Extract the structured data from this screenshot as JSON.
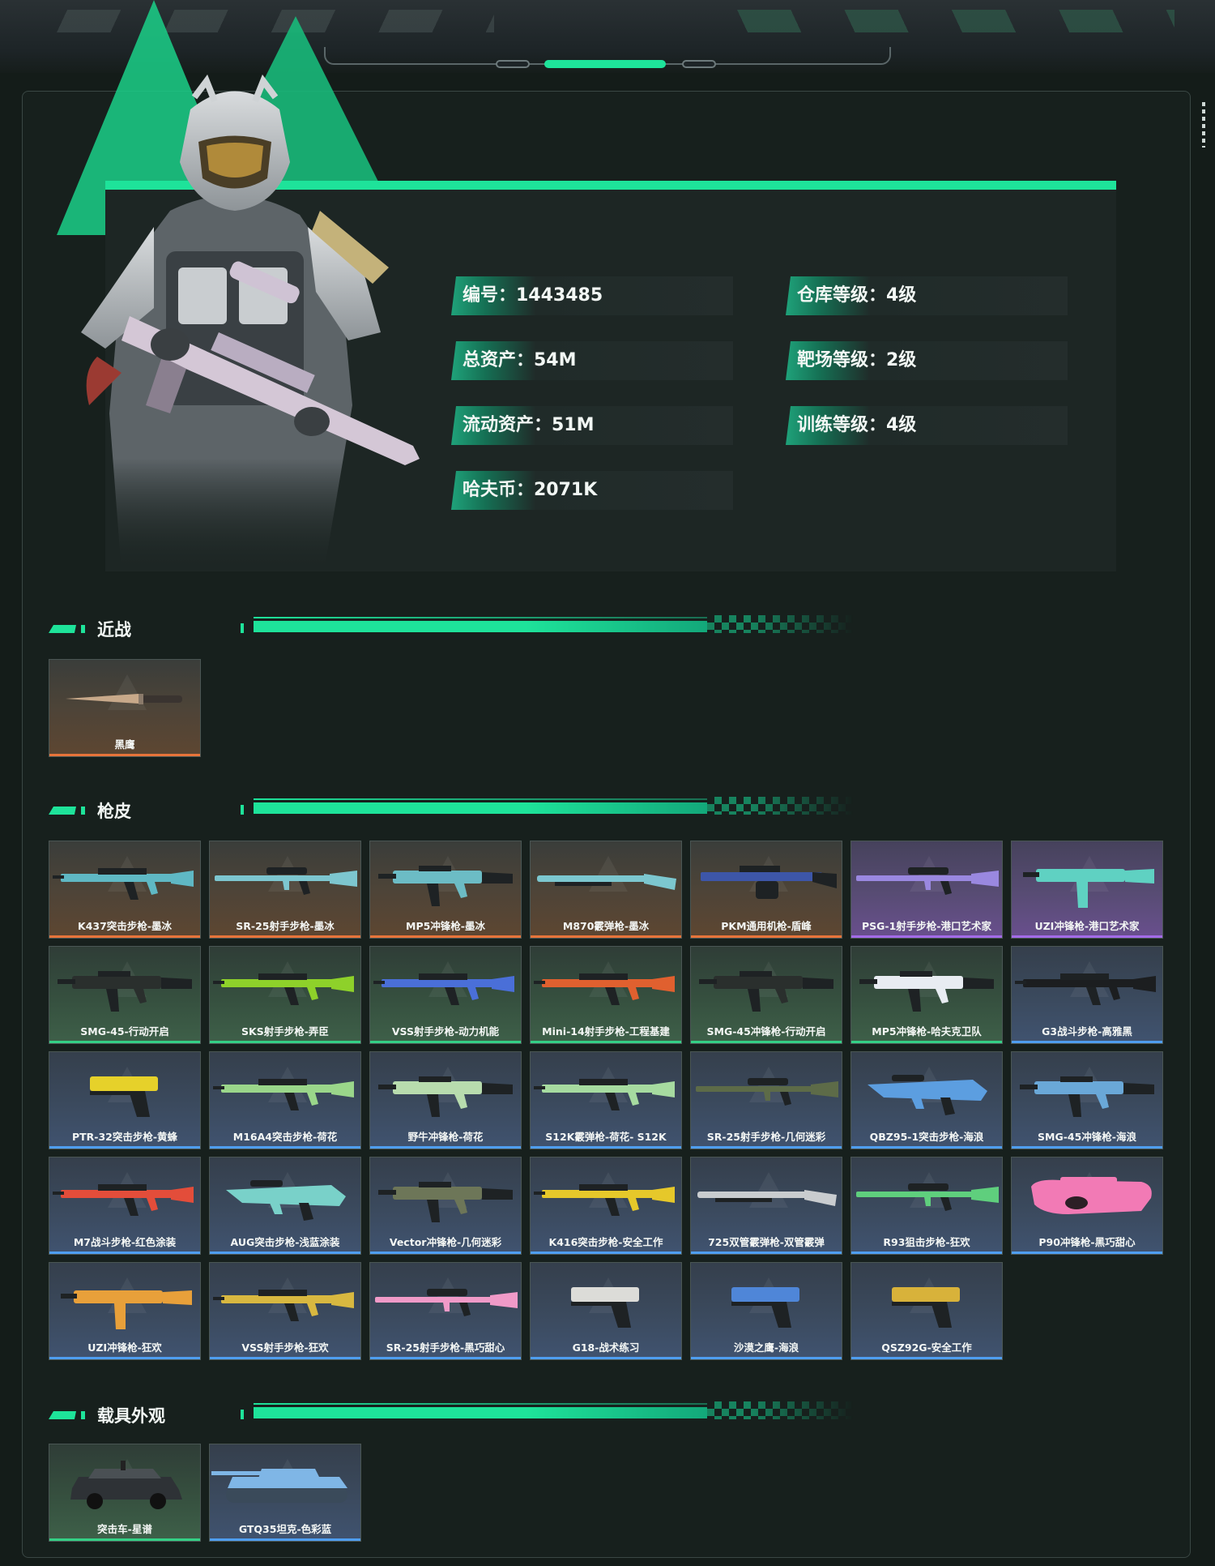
{
  "profile": {
    "stats": [
      {
        "key": "id",
        "text": "编号：1443485"
      },
      {
        "key": "warehouse",
        "text": "仓库等级：4级"
      },
      {
        "key": "assets",
        "text": "总资产：54M"
      },
      {
        "key": "range",
        "text": "靶场等级：2级"
      },
      {
        "key": "liquid",
        "text": "流动资产：51M"
      },
      {
        "key": "training",
        "text": "训练等级：4级"
      },
      {
        "key": "havcoin",
        "text": "哈夫币：2071K"
      }
    ]
  },
  "sections": {
    "melee": {
      "title": "近战",
      "items": [
        {
          "name": "黑鹰",
          "quality": "orange",
          "kind": "knife",
          "color": "#c8a98a"
        }
      ]
    },
    "skins": {
      "title": "枪皮",
      "items": [
        {
          "name": "K437突击步枪-墨冰",
          "quality": "orange",
          "kind": "rifle",
          "color": "#5fb8c4"
        },
        {
          "name": "SR-25射手步枪-墨冰",
          "quality": "orange",
          "kind": "sniper",
          "color": "#7dc6cf"
        },
        {
          "name": "MP5冲锋枪-墨冰",
          "quality": "orange",
          "kind": "smg",
          "color": "#6cbcc5"
        },
        {
          "name": "M870霰弹枪-墨冰",
          "quality": "orange",
          "kind": "shotgun",
          "color": "#7cc7cf"
        },
        {
          "name": "PKM通用机枪-盾峰",
          "quality": "orange",
          "kind": "lmg",
          "color": "#3d56a8"
        },
        {
          "name": "PSG-1射手步枪-港口艺术家",
          "quality": "purple",
          "kind": "sniper",
          "color": "#9a88e0"
        },
        {
          "name": "UZI冲锋枪-港口艺术家",
          "quality": "purple",
          "kind": "uzi",
          "color": "#5fd1c2"
        },
        {
          "name": "SMG-45-行动开启",
          "quality": "green",
          "kind": "smg",
          "color": "#2a2f2d"
        },
        {
          "name": "SKS射手步枪-弄臣",
          "quality": "green",
          "kind": "rifle",
          "color": "#8ed12a"
        },
        {
          "name": "VSS射手步枪-动力机能",
          "quality": "green",
          "kind": "rifle",
          "color": "#4a6fd8"
        },
        {
          "name": "Mini-14射手步枪-工程基建",
          "quality": "green",
          "kind": "rifle",
          "color": "#e0602f"
        },
        {
          "name": "SMG-45冲锋枪-行动开启",
          "quality": "green",
          "kind": "smg",
          "color": "#2a2f2d"
        },
        {
          "name": "MP5冲锋枪-哈夫克卫队",
          "quality": "green",
          "kind": "smg",
          "color": "#e8ecf2"
        },
        {
          "name": "G3战斗步枪-高雅黑",
          "quality": "blue",
          "kind": "rifle",
          "color": "#1c1e20"
        },
        {
          "name": "PTR-32突击步枪-黄蜂",
          "quality": "blue",
          "kind": "pistol",
          "color": "#e6d12a"
        },
        {
          "name": "M16A4突击步枪-荷花",
          "quality": "blue",
          "kind": "rifle",
          "color": "#9ad68a"
        },
        {
          "name": "野牛冲锋枪-荷花",
          "quality": "blue",
          "kind": "smg",
          "color": "#b8dcae"
        },
        {
          "name": "S12K霰弹枪-荷花- S12K",
          "quality": "blue",
          "kind": "rifle",
          "color": "#a6dba0"
        },
        {
          "name": "SR-25射手步枪-几何迷彩",
          "quality": "blue",
          "kind": "sniper",
          "color": "#5d6b48"
        },
        {
          "name": "QBZ95-1突击步枪-海浪",
          "quality": "blue",
          "kind": "bullpup",
          "color": "#5c9ee0"
        },
        {
          "name": "SMG-45冲锋枪-海浪",
          "quality": "blue",
          "kind": "smg",
          "color": "#6aa8d8"
        },
        {
          "name": "M7战斗步枪-红色涂装",
          "quality": "blue",
          "kind": "rifle",
          "color": "#e34d3a"
        },
        {
          "name": "AUG突击步枪-浅蓝涂装",
          "quality": "blue",
          "kind": "bullpup",
          "color": "#79d1c9"
        },
        {
          "name": "Vector冲锋枪-几何迷彩",
          "quality": "blue",
          "kind": "smg",
          "color": "#6d7658"
        },
        {
          "name": "K416突击步枪-安全工作",
          "quality": "blue",
          "kind": "rifle",
          "color": "#e6c82a"
        },
        {
          "name": "725双管霰弹枪-双管霰弹",
          "quality": "blue",
          "kind": "shotgun",
          "color": "#c9cccf"
        },
        {
          "name": "R93狙击步枪-狂欢",
          "quality": "blue",
          "kind": "sniper",
          "color": "#5fcf7d"
        },
        {
          "name": "P90冲锋枪-黑巧甜心",
          "quality": "blue",
          "kind": "p90",
          "color": "#f27ab5"
        },
        {
          "name": "UZI冲锋枪-狂欢",
          "quality": "blue",
          "kind": "uzi",
          "color": "#e8a03a"
        },
        {
          "name": "VSS射手步枪-狂欢",
          "quality": "blue",
          "kind": "rifle",
          "color": "#d8b840"
        },
        {
          "name": "SR-25射手步枪-黑巧甜心",
          "quality": "blue",
          "kind": "sniper",
          "color": "#f09ac8"
        },
        {
          "name": "G18-战术练习",
          "quality": "blue",
          "kind": "pistol",
          "color": "#dcdcd8"
        },
        {
          "name": "沙漠之鹰-海浪",
          "quality": "blue",
          "kind": "pistol",
          "color": "#4f86d8"
        },
        {
          "name": "QSZ92G-安全工作",
          "quality": "blue",
          "kind": "pistol",
          "color": "#d8b23a"
        }
      ]
    },
    "vehicles": {
      "title": "载具外观",
      "items": [
        {
          "name": "突击车-星谱",
          "quality": "green",
          "kind": "car",
          "color": "#2e3236"
        },
        {
          "name": "GTQ35坦克-色彩蓝",
          "quality": "blue",
          "kind": "tank",
          "color": "#7fb6e6"
        }
      ]
    }
  },
  "colors": {
    "accent": "#1ee39a",
    "quality_orange": "#e8743a",
    "quality_purple": "#a36be8",
    "quality_green": "#34d086",
    "quality_blue": "#4f9ef0"
  }
}
